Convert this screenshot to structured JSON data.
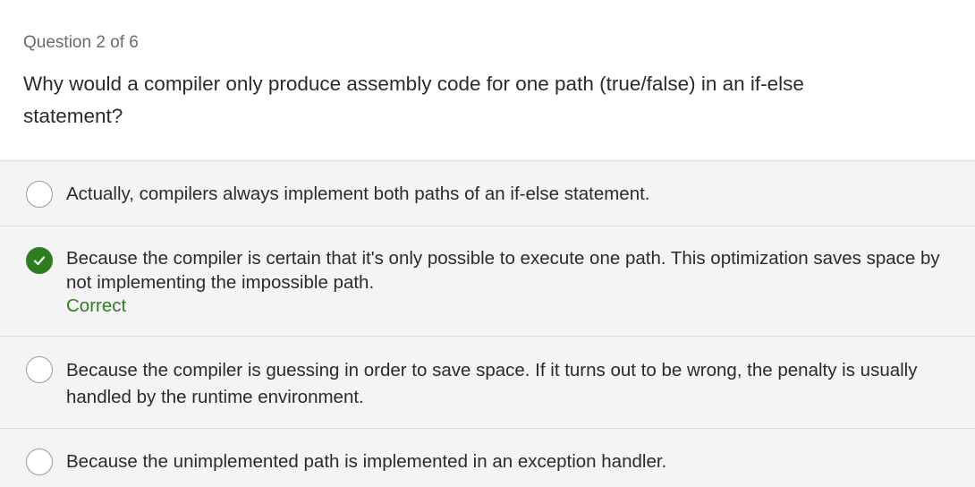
{
  "quiz": {
    "counter": "Question 2 of 6",
    "question": "Why would a compiler only produce assembly code for one path (true/false) in an if-else statement?",
    "options": [
      {
        "text": "Actually, compilers always implement both paths of an if-else statement.",
        "state": "unselected"
      },
      {
        "text": "Because the compiler is certain that it's only possible to execute one path. This optimization saves space by not implementing the impossible path.",
        "state": "selected-correct",
        "feedback": "Correct"
      },
      {
        "text": "Because the compiler is guessing in order to save space. If it turns out to be wrong, the penalty is usually handled by the runtime environment.",
        "state": "unselected"
      },
      {
        "text": "Because the unimplemented path is implemented in an exception handler.",
        "state": "unselected"
      }
    ]
  },
  "colors": {
    "correct": "#2e7d1f",
    "option_bg": "#f4f4f4",
    "divider": "#dcdcdc"
  },
  "icons": {
    "selected": "checkmark-circle-icon",
    "unselected": "radio-circle-icon"
  }
}
